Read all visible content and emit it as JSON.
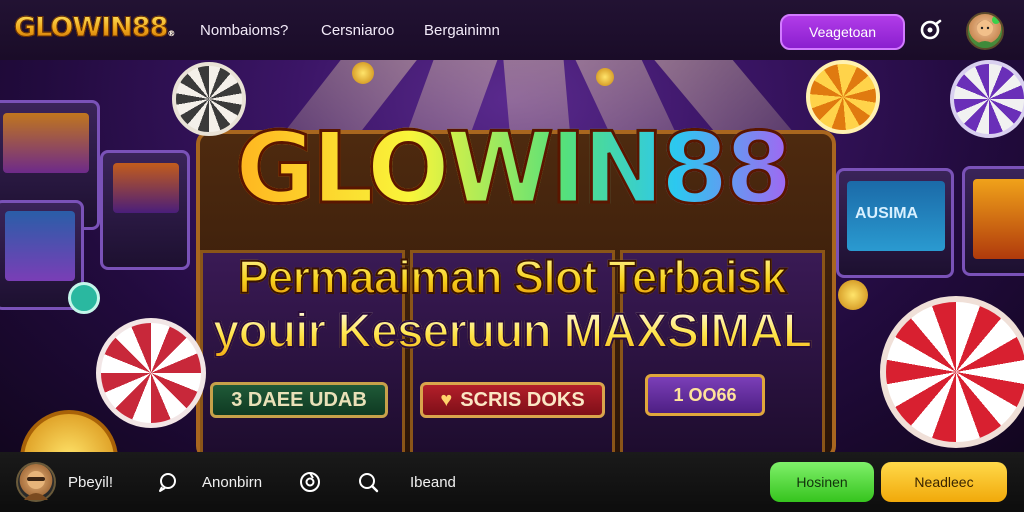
{
  "header": {
    "logo": "GLOWIN88",
    "nav": [
      "Nombaioms?",
      "Cersniaroo",
      "Bergainimn"
    ],
    "cta_label": "Veagetoan",
    "search_icon": "search-icon",
    "avatar_icon": "user-avatar"
  },
  "hero": {
    "title": "GLOWIN88",
    "subtitle_line1": "Permaaiman Slot Terbaisk",
    "subtitle_line2": "youir Keseruun MAXSIMAL",
    "panel_left": "3 DAEE UDAB",
    "panel_middle": "SCRIS DOKS",
    "panel_right": "1 OO66",
    "side_screen": "AUSIMA"
  },
  "footer": {
    "profile_label": "Pbeyil!",
    "item2_label": "Anonbirn",
    "item3_label": "Ibeand",
    "btn_green": "Hosinen",
    "btn_yellow": "Neadleec"
  },
  "colors": {
    "accent_purple": "#9b2ad6",
    "btn_green": "#4ad32e",
    "btn_yellow": "#f7b51a",
    "topbar_bg": "#1d0f2b",
    "bottombar_bg": "#141414"
  }
}
